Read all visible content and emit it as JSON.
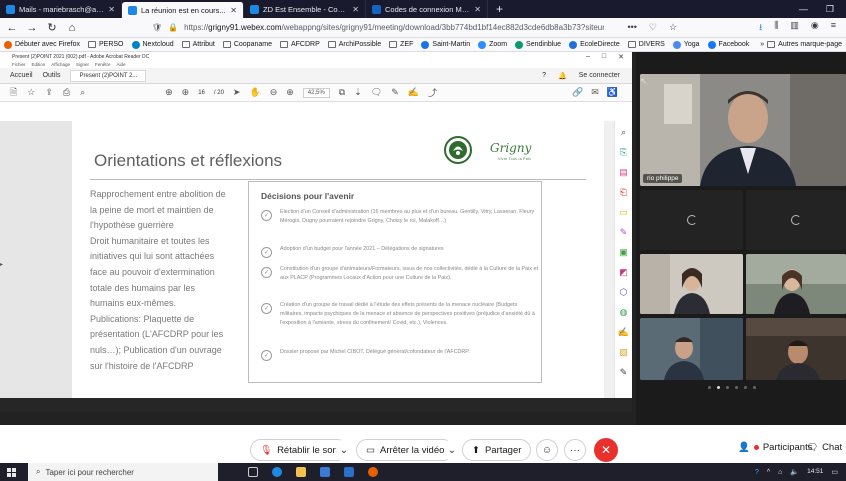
{
  "browser": {
    "tabs": [
      {
        "title": "Mails - mariebrasch@alternati",
        "color": "#1e88e5",
        "active": false
      },
      {
        "title": "La réunion est en cours...",
        "color": "#1e88e5",
        "active": true
      },
      {
        "title": "ZD Est Ensemble - Coopanam",
        "color": "#1e88e5",
        "active": false
      },
      {
        "title": "Codes de connexion MAJ le 16",
        "color": "#1565c0",
        "active": false
      }
    ],
    "new_tab": "+",
    "url_host": "grigny91.webex.com",
    "url_path": "/webappng/sites/grigny91/meeting/download/3bb774bd1bf14ec882d3cde6db8a3b73?siteurl",
    "url_prefix": "https://"
  },
  "bookmarks": [
    {
      "label": "Débuter avec Firefox",
      "kind": "dot",
      "color": "#e66000"
    },
    {
      "label": "PERSO",
      "kind": "folder"
    },
    {
      "label": "Nextcloud",
      "kind": "dot",
      "color": "#0082c9"
    },
    {
      "label": "Attribut",
      "kind": "folder"
    },
    {
      "label": "Coopaname",
      "kind": "folder"
    },
    {
      "label": "AFCDRP",
      "kind": "folder"
    },
    {
      "label": "ArchiPossible",
      "kind": "folder"
    },
    {
      "label": "ZEF",
      "kind": "folder"
    },
    {
      "label": "Saint-Martin",
      "kind": "dot",
      "color": "#1a73e8"
    },
    {
      "label": "Zoom",
      "kind": "dot",
      "color": "#2d8cff"
    },
    {
      "label": "Sendinblue",
      "kind": "dot",
      "color": "#0b996e"
    },
    {
      "label": "EcoleDirecte",
      "kind": "dot",
      "color": "#1e6fd9"
    },
    {
      "label": "DIVERS",
      "kind": "folder"
    },
    {
      "label": "Yoga",
      "kind": "dot",
      "color": "#4c8bf5"
    },
    {
      "label": "Facebook",
      "kind": "dot",
      "color": "#1877f2"
    }
  ],
  "bookmarks_more": "Autres marque-page",
  "acrobat": {
    "title": "Present (2)POINT 2021 (002).pdf - Adobe Acrobat Reader DC",
    "menu": [
      "Fichier",
      "Edition",
      "Affichage",
      "Signer",
      "Fenêtre",
      "Aide"
    ],
    "home_tab": "Accueil",
    "tools_tab": "Outils",
    "doc_tab": "Present (2)POINT 2...",
    "sign_in": "Se connecter",
    "page_current": "16",
    "page_total": "/ 20",
    "zoom": "42,5%"
  },
  "slide": {
    "title": "Orientations et réflexions",
    "logo_script": "Grigny",
    "logo_tagline": "Vivre Tous la Paix",
    "left_lines": [
      "Rapprochement entre abolition de",
      "la peine de mort et maintien de",
      "l'hypothèse guerrière",
      "Droit humanitaire et toutes les",
      "initiatives qui lui sont attachées",
      "face au pouvoir d'extermination",
      "totale des humains par les",
      "humains eux-mêmes.",
      "Publications: Plaquette de",
      "présentation (L'AFCDRP pour les",
      "nuls…); Publication d'un ouvrage",
      "sur l'histoire de l'AFCDRP"
    ],
    "decisions_title": "Décisions pour l'avenir",
    "decisions": [
      "Election d'un Conseil d'administration (16 membres au plus et d'un bureau. Gentilly, Vitry, Lasseran, Fleury Mérogis, Dugny pourraient rejoindre Grigny, Choisy le roi, Malakoff…)",
      "Adoption d'un budget pour l'année 2021 – Délégations de signatures",
      "Constitution d'un groupe d'animateurs/Formateurs, issus de nos collectivités, dédié à la Culture de la Paix et aux PLACP (Programmes Locaux d'Action pour une Culture de la Paix).",
      "Création d'un groupe de travail dédié à l'étude des effets présents de la menace nucléaire (Budgets militaires, impacts psychiques de la menace et absence de perspectives positives (préjudice d'anxiété dû à l'exposition à l'amiante, stress du confinement/ Covid, etc.), Violences.",
      "Dossier proposé par Michel CIBOT, Délégué général/cofondateur de l'AFCDRP."
    ]
  },
  "participants": {
    "speaker_name": "rio philippe"
  },
  "controls": {
    "audio": "Rétablir le son",
    "video": "Arrêter la vidéo",
    "share": "Partager",
    "participants": "Participants",
    "chat": "Chat"
  },
  "taskbar": {
    "search_placeholder": "Taper ici pour rechercher",
    "time": "14:51"
  },
  "colors": {
    "leave_button": "#e9312c",
    "tab_bar": "#1a1a2e",
    "accent_green": "#3a7a3c"
  }
}
